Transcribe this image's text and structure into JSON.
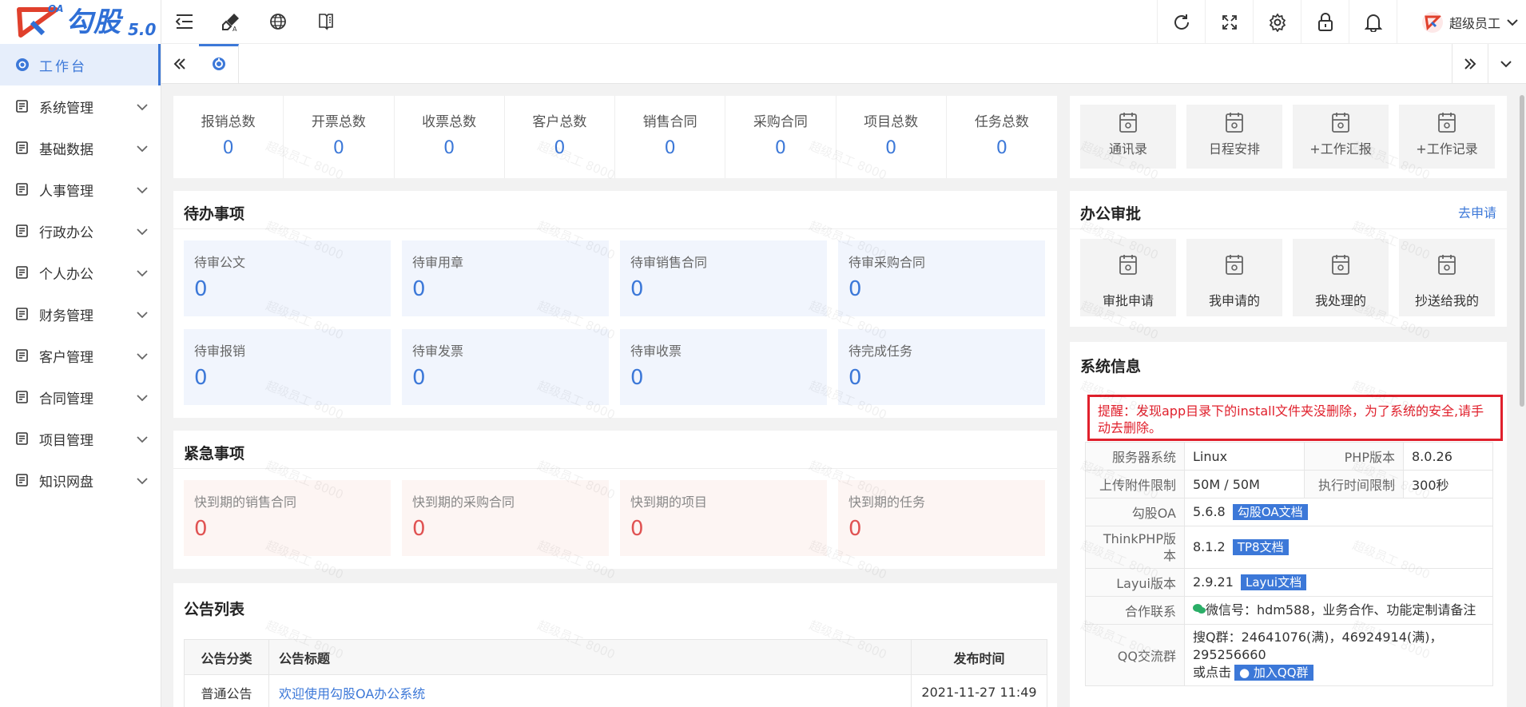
{
  "app": {
    "logo_text": "勾股",
    "logo_oa": "OA",
    "logo_version": "5.0"
  },
  "sidebar": {
    "items": [
      {
        "label": "工作台",
        "icon": "dashboard-icon",
        "active": true
      },
      {
        "label": "系统管理",
        "icon": "system-gear-icon"
      },
      {
        "label": "基础数据",
        "icon": "data-icon"
      },
      {
        "label": "人事管理",
        "icon": "people-icon"
      },
      {
        "label": "行政办公",
        "icon": "office-icon"
      },
      {
        "label": "个人办公",
        "icon": "personal-icon"
      },
      {
        "label": "财务管理",
        "icon": "finance-icon"
      },
      {
        "label": "客户管理",
        "icon": "customer-icon"
      },
      {
        "label": "合同管理",
        "icon": "contract-icon"
      },
      {
        "label": "项目管理",
        "icon": "project-icon"
      },
      {
        "label": "知识网盘",
        "icon": "disk-icon"
      }
    ]
  },
  "header": {
    "user_name": "超级员工"
  },
  "stats": [
    {
      "label": "报销总数",
      "value": "0"
    },
    {
      "label": "开票总数",
      "value": "0"
    },
    {
      "label": "收票总数",
      "value": "0"
    },
    {
      "label": "客户总数",
      "value": "0"
    },
    {
      "label": "销售合同",
      "value": "0"
    },
    {
      "label": "采购合同",
      "value": "0"
    },
    {
      "label": "项目总数",
      "value": "0"
    },
    {
      "label": "任务总数",
      "value": "0"
    }
  ],
  "todo": {
    "title": "待办事项",
    "items": [
      {
        "label": "待审公文",
        "value": "0"
      },
      {
        "label": "待审用章",
        "value": "0"
      },
      {
        "label": "待审销售合同",
        "value": "0"
      },
      {
        "label": "待审采购合同",
        "value": "0"
      },
      {
        "label": "待审报销",
        "value": "0"
      },
      {
        "label": "待审发票",
        "value": "0"
      },
      {
        "label": "待审收票",
        "value": "0"
      },
      {
        "label": "待完成任务",
        "value": "0"
      }
    ]
  },
  "urgent": {
    "title": "紧急事项",
    "items": [
      {
        "label": "快到期的销售合同",
        "value": "0"
      },
      {
        "label": "快到期的采购合同",
        "value": "0"
      },
      {
        "label": "快到期的项目",
        "value": "0"
      },
      {
        "label": "快到期的任务",
        "value": "0"
      }
    ]
  },
  "notices": {
    "title": "公告列表",
    "columns": [
      "公告分类",
      "公告标题",
      "发布时间"
    ],
    "rows": [
      {
        "category": "普通公告",
        "title": "欢迎使用勾股OA办公系统",
        "time": "2021-11-27 11:49"
      }
    ]
  },
  "quick_links": [
    {
      "label": "通讯录",
      "icon": "contacts-icon"
    },
    {
      "label": "日程安排",
      "icon": "schedule-icon"
    },
    {
      "label": "+工作汇报",
      "icon": "report-calendar-icon"
    },
    {
      "label": "+工作记录",
      "icon": "record-icon"
    }
  ],
  "approval": {
    "title": "办公审批",
    "action": "去申请",
    "items": [
      {
        "label": "审批申请",
        "icon": "approve-calendar-icon"
      },
      {
        "label": "我申请的",
        "icon": "person-icon"
      },
      {
        "label": "我处理的",
        "icon": "processed-icon"
      },
      {
        "label": "抄送给我的",
        "icon": "cc-icon"
      }
    ]
  },
  "sysinfo": {
    "title": "系统信息",
    "alert": "提醒：发现app目录下的install文件夹没删除，为了系统的安全,请手动去删除。",
    "server_os_label": "服务器系统",
    "server_os": "Linux",
    "php_label": "PHP版本",
    "php": "8.0.26",
    "upload_label": "上传附件限制",
    "upload": "50M / 50M",
    "exec_label": "执行时间限制",
    "exec": "300秒",
    "gouguoa_label": "勾股OA",
    "gouguoa": "5.6.8",
    "gouguoa_doc": "勾股OA文档",
    "thinkphp_label": "ThinkPHP版本",
    "thinkphp": "8.1.2",
    "thinkphp_doc": "TP8文档",
    "layui_label": "Layui版本",
    "layui": "2.9.21",
    "layui_doc": "Layui文档",
    "contact_label": "合作联系",
    "contact": "微信号：hdm588，业务合作、功能定制请备注",
    "qq_label": "QQ交流群",
    "qq": "搜Q群：24641076(满)，46924914(满)，295256660",
    "qq_click": "或点击",
    "qq_join": "加入QQ群"
  },
  "watermark": "超级员工 8000"
}
